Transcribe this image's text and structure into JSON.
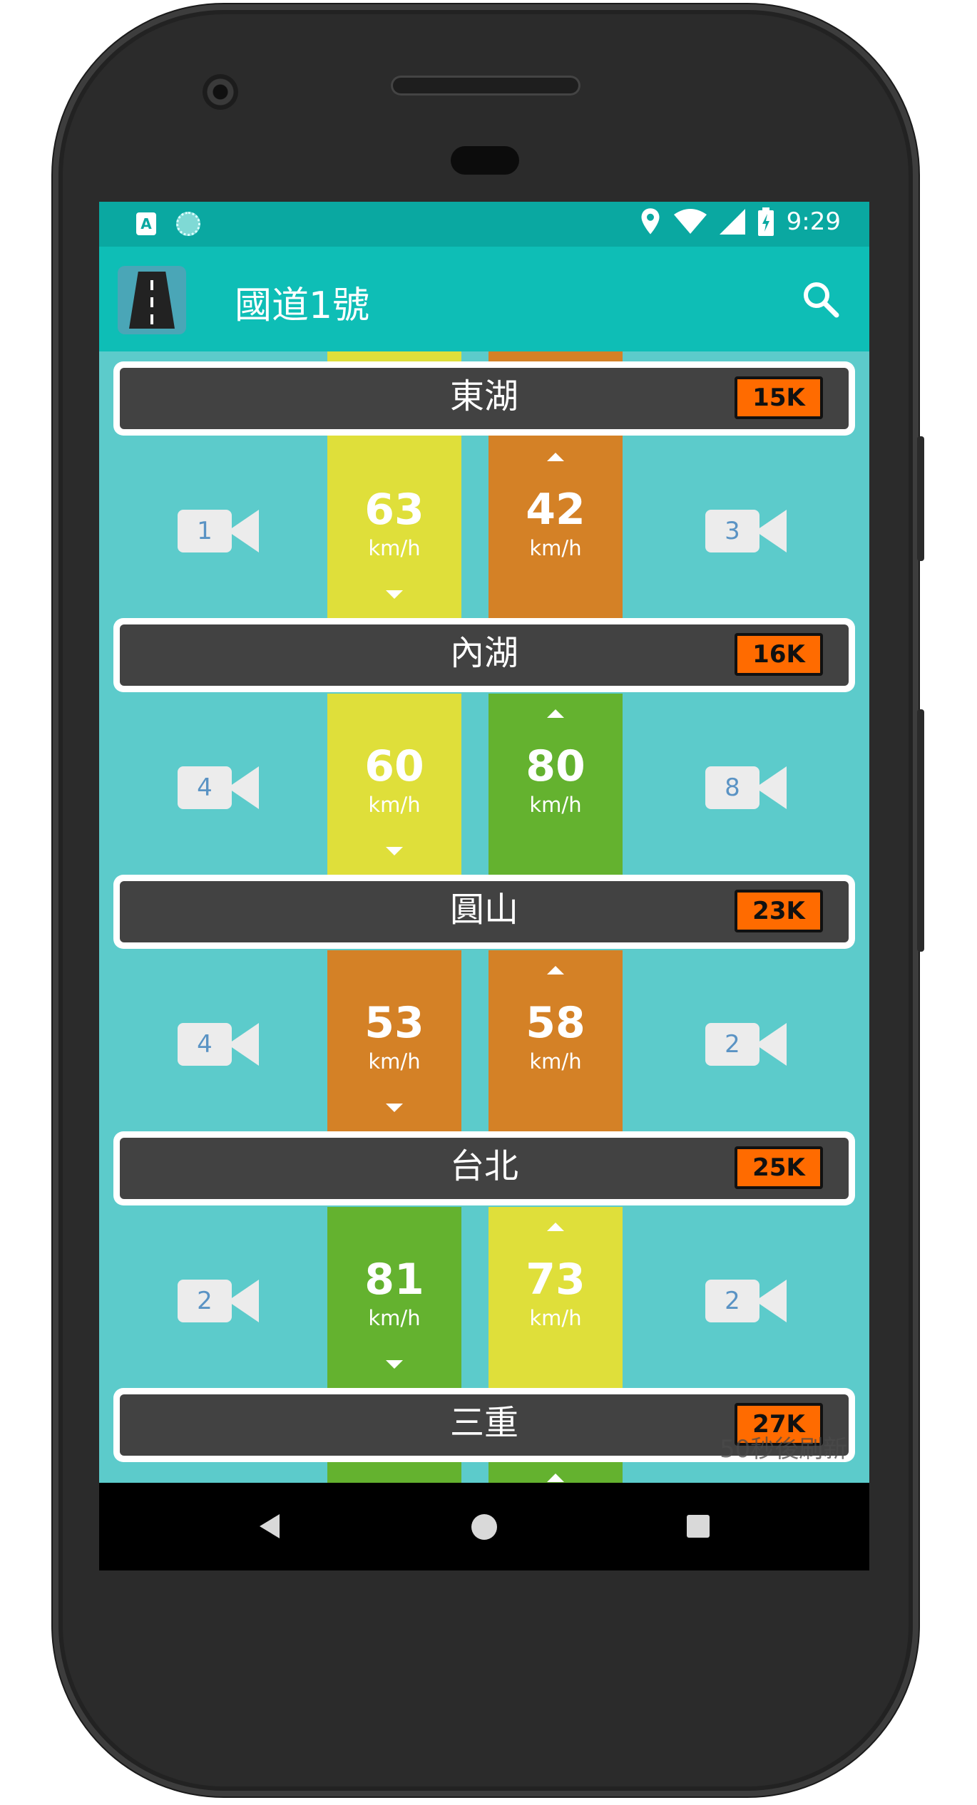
{
  "status_bar": {
    "time": "9:29",
    "notification_letter": "A"
  },
  "app_bar": {
    "title": "國道1號"
  },
  "stations": [
    {
      "name": "東湖",
      "km": "15K"
    },
    {
      "name": "內湖",
      "km": "16K"
    },
    {
      "name": "圓山",
      "km": "23K"
    },
    {
      "name": "台北",
      "km": "25K"
    },
    {
      "name": "三重",
      "km": "27K"
    }
  ],
  "segments": [
    {
      "south_speed": "63",
      "south_color": "#dfdf3a",
      "north_speed": "42",
      "north_color": "#d48126",
      "left_cameras": "1",
      "right_cameras": "3"
    },
    {
      "south_speed": "60",
      "south_color": "#dfdf3a",
      "north_speed": "80",
      "north_color": "#64b22f",
      "left_cameras": "4",
      "right_cameras": "8"
    },
    {
      "south_speed": "53",
      "south_color": "#d48126",
      "north_speed": "58",
      "north_color": "#d48126",
      "left_cameras": "4",
      "right_cameras": "2"
    },
    {
      "south_speed": "81",
      "south_color": "#64b22f",
      "north_speed": "73",
      "north_color": "#dfdf3a",
      "left_cameras": "2",
      "right_cameras": "2"
    }
  ],
  "unit": "km/h",
  "refresh_text": "50秒後刷新",
  "colors": {
    "status_bar": "#0aa8a1",
    "app_bar": "#0ebeb6",
    "background": "#5ccbcb",
    "badge": "#ff6b00"
  },
  "icons": {
    "search": "search-icon",
    "back": "back-icon",
    "home": "home-icon",
    "recent": "recent-apps-icon",
    "camera": "camera-icon",
    "location": "location-icon",
    "wifi": "wifi-icon",
    "signal": "signal-icon",
    "battery": "battery-icon"
  }
}
